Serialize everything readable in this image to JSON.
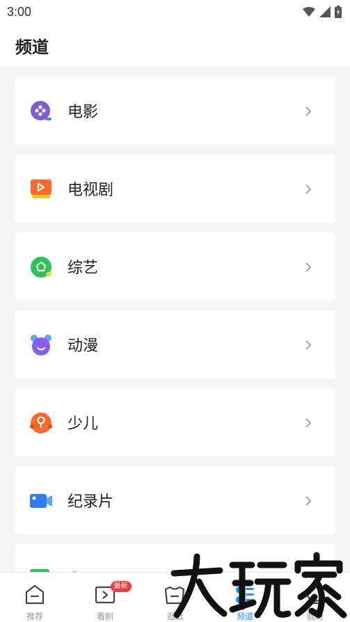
{
  "status": {
    "time": "3:00"
  },
  "header": {
    "title": "频道"
  },
  "channels": [
    {
      "label": "电影",
      "icon": "movie-icon",
      "color": "#7b5cd6"
    },
    {
      "label": "电视剧",
      "icon": "tv-series-icon",
      "color": "#ff6a2b"
    },
    {
      "label": "综艺",
      "icon": "variety-icon",
      "color": "#2ec25b"
    },
    {
      "label": "动漫",
      "icon": "anime-icon",
      "color": "#8a5cf0"
    },
    {
      "label": "少儿",
      "icon": "kids-icon",
      "color": "#ff6a2b"
    },
    {
      "label": "纪录片",
      "icon": "documentary-icon",
      "color": "#2f7cf6"
    },
    {
      "label": "专题",
      "icon": "topic-icon",
      "color": "#2ec25b"
    }
  ],
  "tabbar": {
    "tabs": [
      {
        "label": "推荐",
        "icon": "home-icon"
      },
      {
        "label": "看剧",
        "icon": "tv-icon",
        "badge": "最新"
      },
      {
        "label": "逛逛",
        "icon": "browse-icon"
      },
      {
        "label": "频道",
        "icon": "channel-icon",
        "active": true
      },
      {
        "label": "我的",
        "icon": "profile-icon"
      }
    ]
  },
  "watermark": {
    "text": "大玩家"
  },
  "colors": {
    "accent": "#1e90ff",
    "badge": "#f23c3c"
  }
}
